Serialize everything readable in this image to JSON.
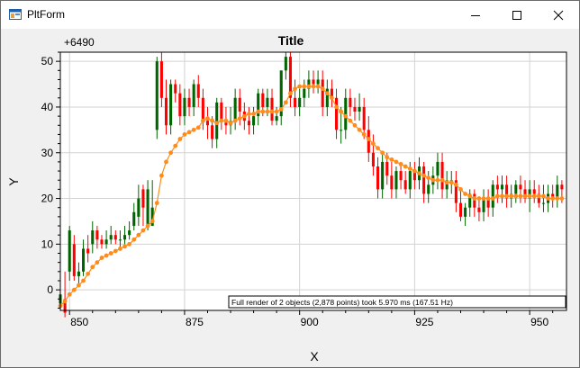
{
  "window": {
    "title": "PltForm",
    "app_icon": "form-icon",
    "buttons": {
      "minimize": "minimize-icon",
      "maximize": "maximize-icon",
      "close": "close-icon"
    }
  },
  "plot": {
    "title": "Title",
    "xlabel": "X",
    "ylabel": "Y",
    "offset_label": "+6490",
    "benchmark": "Full render of 2 objects (2,878 points) took 5.970 ms (167.51 Hz)",
    "colors": {
      "up": "#006400",
      "down": "#ff0000",
      "ma": "#ff8c1a",
      "grid": "#d3d3d3",
      "background": "#ffffff"
    }
  },
  "chart_data": {
    "type": "candlestick",
    "title": "Title",
    "xlabel": "X",
    "ylabel": "Y",
    "x_offset": 6490,
    "xlim": [
      848,
      958
    ],
    "ylim": [
      -4.5,
      52
    ],
    "x_ticks": [
      850,
      875,
      900,
      925,
      950
    ],
    "y_ticks": [
      0,
      10,
      20,
      30,
      40,
      50
    ],
    "grid": true,
    "series": [
      {
        "kind": "ohlc",
        "x": [
          848,
          849,
          850,
          851,
          852,
          853,
          854,
          855,
          856,
          857,
          858,
          859,
          860,
          861,
          862,
          863,
          864,
          865,
          866,
          867,
          868,
          869,
          870,
          871,
          872,
          873,
          874,
          875,
          876,
          877,
          878,
          879,
          880,
          881,
          882,
          883,
          884,
          885,
          886,
          887,
          888,
          889,
          890,
          891,
          892,
          893,
          894,
          895,
          896,
          897,
          898,
          899,
          900,
          901,
          902,
          903,
          904,
          905,
          906,
          907,
          908,
          909,
          910,
          911,
          912,
          913,
          914,
          915,
          916,
          917,
          918,
          919,
          920,
          921,
          922,
          923,
          924,
          925,
          926,
          927,
          928,
          929,
          930,
          931,
          932,
          933,
          934,
          935,
          936,
          937,
          938,
          939,
          940,
          941,
          942,
          943,
          944,
          945,
          946,
          947,
          948,
          949,
          950,
          951,
          952,
          953,
          954,
          955,
          956,
          957
        ],
        "open": [
          -3,
          -2,
          4,
          10,
          3,
          4,
          9,
          10,
          13,
          11,
          10,
          11,
          12,
          11,
          11,
          12,
          14,
          16,
          22,
          14,
          14,
          35,
          50,
          42,
          36,
          45,
          43,
          38,
          42,
          40,
          45,
          42,
          37,
          36,
          33,
          41,
          37,
          36,
          37,
          42,
          39,
          37,
          36,
          38,
          43,
          40,
          42,
          37,
          38,
          48,
          51,
          42,
          40,
          42,
          44,
          46,
          45,
          46,
          40,
          44,
          42,
          35,
          35,
          42,
          40,
          39,
          40,
          35,
          30,
          27,
          22,
          28,
          25,
          22,
          26,
          24,
          22,
          26,
          24,
          27,
          21,
          23,
          25,
          28,
          22,
          24,
          24,
          19,
          16,
          18,
          21,
          18,
          17,
          20,
          18,
          23,
          22,
          23,
          20,
          21,
          23,
          22,
          20,
          22,
          21,
          19,
          19,
          21,
          20,
          23
        ],
        "close": [
          -1,
          -5,
          13,
          3,
          4,
          9,
          8,
          13,
          11,
          10,
          11,
          12,
          11,
          11,
          12,
          13,
          17,
          20,
          18,
          22,
          18,
          50,
          42,
          36,
          45,
          43,
          38,
          42,
          40,
          45,
          42,
          37,
          36,
          33,
          41,
          37,
          36,
          37,
          42,
          39,
          37,
          36,
          38,
          43,
          40,
          42,
          37,
          38,
          48,
          51,
          42,
          40,
          42,
          44,
          46,
          45,
          46,
          40,
          44,
          42,
          35,
          35,
          42,
          40,
          39,
          40,
          35,
          30,
          27,
          22,
          28,
          25,
          22,
          26,
          24,
          22,
          26,
          24,
          27,
          21,
          23,
          25,
          28,
          22,
          24,
          24,
          19,
          16,
          18,
          21,
          18,
          17,
          20,
          18,
          23,
          22,
          23,
          20,
          21,
          23,
          22,
          20,
          22,
          21,
          19,
          19,
          21,
          20,
          23,
          22
        ],
        "high": [
          2,
          4,
          14,
          12,
          6,
          11,
          12,
          15,
          14,
          12,
          13,
          14,
          13,
          13,
          14,
          15,
          19,
          23,
          23,
          24,
          24,
          51,
          52,
          46,
          46,
          46,
          45,
          44,
          44,
          46,
          47,
          44,
          40,
          38,
          42,
          42,
          40,
          40,
          44,
          44,
          41,
          40,
          40,
          44,
          44,
          44,
          44,
          40,
          48,
          52,
          52,
          46,
          44,
          46,
          48,
          48,
          48,
          48,
          46,
          46,
          44,
          40,
          44,
          44,
          42,
          43,
          42,
          38,
          34,
          29,
          30,
          30,
          28,
          27,
          28,
          26,
          28,
          28,
          29,
          28,
          26,
          27,
          30,
          30,
          26,
          26,
          26,
          22,
          19,
          22,
          22,
          20,
          22,
          22,
          24,
          25,
          25,
          25,
          23,
          24,
          25,
          24,
          24,
          24,
          23,
          23,
          23,
          23,
          25,
          24
        ],
        "low": [
          -4,
          -6,
          2,
          2,
          1,
          3,
          6,
          8,
          9,
          9,
          9,
          10,
          10,
          9,
          10,
          11,
          13,
          14,
          14,
          13,
          14,
          33,
          40,
          34,
          34,
          41,
          36,
          36,
          38,
          38,
          40,
          35,
          33,
          31,
          31,
          35,
          34,
          34,
          35,
          36,
          35,
          34,
          34,
          36,
          38,
          38,
          36,
          36,
          36,
          46,
          40,
          38,
          38,
          40,
          42,
          43,
          43,
          38,
          38,
          40,
          33,
          32,
          33,
          38,
          37,
          37,
          33,
          28,
          25,
          20,
          20,
          23,
          20,
          20,
          22,
          21,
          20,
          22,
          22,
          19,
          19,
          21,
          22,
          20,
          20,
          21,
          17,
          15,
          14,
          16,
          16,
          15,
          15,
          16,
          16,
          19,
          19,
          18,
          18,
          19,
          19,
          19,
          17,
          19,
          18,
          17,
          17,
          18,
          18,
          19
        ]
      },
      {
        "kind": "line",
        "name": "",
        "x": [
          848,
          849,
          850,
          851,
          852,
          853,
          854,
          855,
          856,
          857,
          858,
          859,
          860,
          861,
          862,
          863,
          864,
          865,
          866,
          867,
          868,
          869,
          870,
          871,
          872,
          873,
          874,
          875,
          876,
          877,
          878,
          879,
          880,
          881,
          882,
          883,
          884,
          885,
          886,
          887,
          888,
          889,
          890,
          891,
          892,
          893,
          894,
          895,
          896,
          897,
          898,
          899,
          900,
          901,
          902,
          903,
          904,
          905,
          906,
          907,
          908,
          909,
          910,
          911,
          912,
          913,
          914,
          915,
          916,
          917,
          918,
          919,
          920,
          921,
          922,
          923,
          924,
          925,
          926,
          927,
          928,
          929,
          930,
          931,
          932,
          933,
          934,
          935,
          936,
          937,
          938,
          939,
          940,
          941,
          942,
          943,
          944,
          945,
          946,
          947,
          948,
          949,
          950,
          951,
          952,
          953,
          954,
          955,
          956,
          957
        ],
        "y": [
          -3.5,
          -2.5,
          -1,
          0,
          1,
          2,
          3.5,
          5,
          6,
          7,
          7.5,
          8,
          8.5,
          9,
          9.5,
          10,
          11,
          12,
          13,
          14,
          15,
          19,
          25,
          28,
          30,
          31.5,
          33,
          34,
          34.5,
          35,
          35.5,
          37,
          37.5,
          37,
          36.5,
          37,
          37,
          36.5,
          37,
          37.5,
          38,
          38.5,
          38.5,
          39,
          39,
          39,
          39,
          39,
          39.5,
          41,
          43,
          44,
          44.5,
          44.5,
          44.5,
          44.5,
          44.5,
          44,
          43,
          42,
          40,
          39,
          38,
          37,
          36,
          35,
          34,
          33,
          32,
          31,
          30,
          29,
          28.5,
          28,
          27.5,
          27,
          26.5,
          26,
          25.5,
          25,
          24.5,
          24,
          24,
          24,
          23.5,
          23.5,
          23,
          22,
          21,
          20.5,
          20,
          20,
          20,
          20,
          20,
          20.5,
          20.5,
          20.5,
          20.5,
          20.5,
          20.5,
          20.5,
          20.5,
          20.5,
          20.5,
          20.5,
          20,
          20,
          20,
          20
        ]
      }
    ]
  }
}
